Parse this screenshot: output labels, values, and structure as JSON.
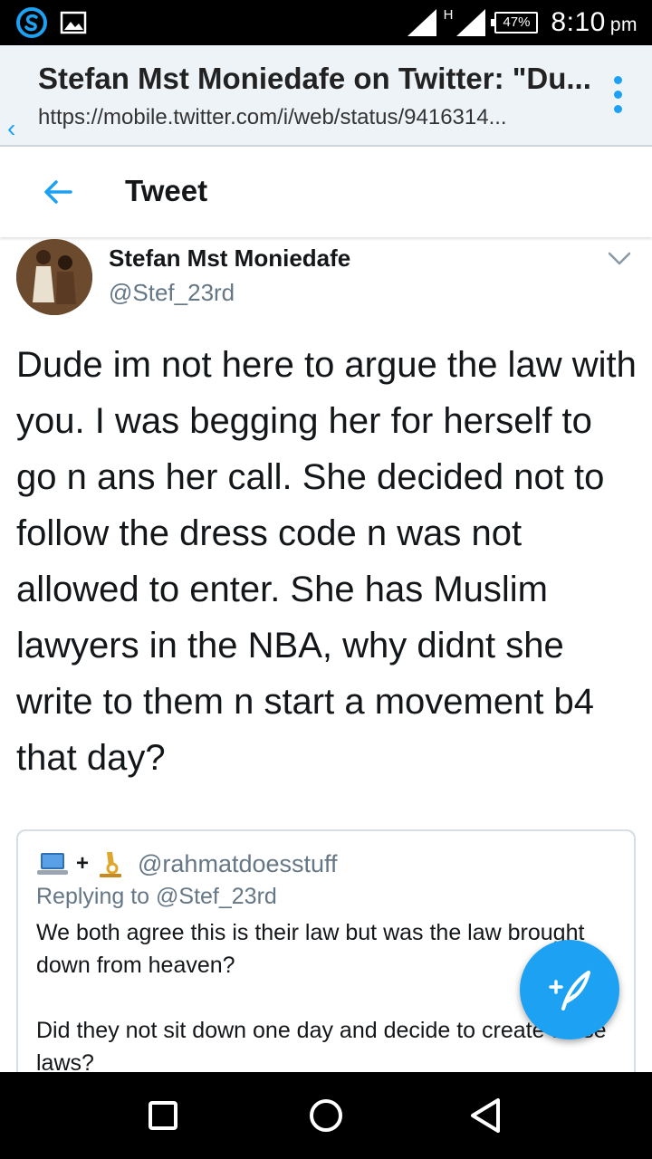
{
  "status_bar": {
    "time": "8:10",
    "ampm": "pm",
    "battery": "47%",
    "network": "H"
  },
  "browser": {
    "title": "Stefan Mst Moniedafe on Twitter: \"Du...",
    "url": "https://mobile.twitter.com/i/web/status/9416314..."
  },
  "header": {
    "title": "Tweet"
  },
  "tweet": {
    "author_name": "Stefan Mst Moniedafe",
    "author_handle": "@Stef_23rd",
    "text": "Dude im not here to argue the law with you. I was begging her for herself to go n ans her call. She decided not to follow the dress code n was not allowed to enter. She has Muslim lawyers in the NBA, why didnt she write to them n start a movement b4 that day?"
  },
  "quoted": {
    "handle": "@rahmatdoesstuff",
    "replying_to": "Replying to @Stef_23rd",
    "body": "We both agree this is their law but was the law brought down from heaven?\n\n Did they not sit down one day and decide to create these laws?"
  },
  "colors": {
    "accent": "#1da1f2",
    "text": "#14171a",
    "muted": "#657786"
  },
  "icons": {
    "status_left": [
      "swiftkey-icon",
      "gallery-icon"
    ],
    "status_right": [
      "signal-icon",
      "battery-icon"
    ],
    "compose": "compose-tweet-icon",
    "nav": [
      "recents-icon",
      "home-icon",
      "back-icon"
    ]
  }
}
